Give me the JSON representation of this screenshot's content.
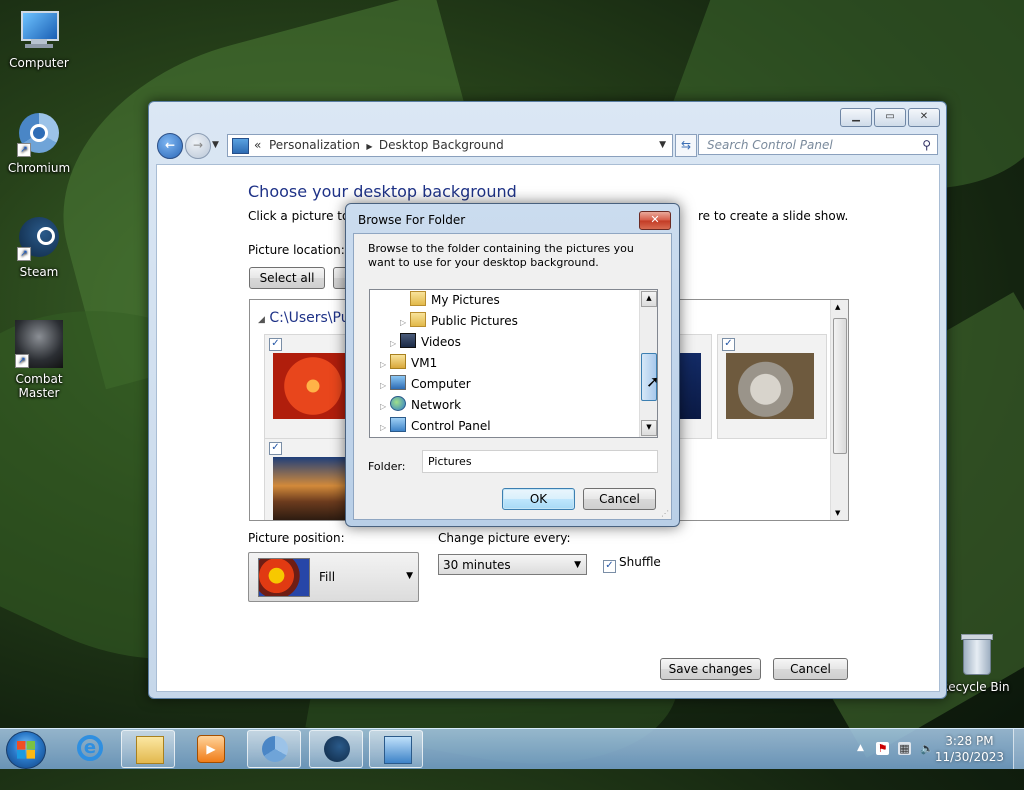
{
  "desktop": {
    "icons": [
      {
        "label": "Computer"
      },
      {
        "label": "Chromium"
      },
      {
        "label": "Steam"
      },
      {
        "label": "Combat Master"
      },
      {
        "label": "Recycle Bin"
      }
    ]
  },
  "window": {
    "breadcrumb_prefix": "«",
    "breadcrumb": [
      "Personalization",
      "Desktop Background"
    ],
    "search_placeholder": "Search Control Panel",
    "heading": "Choose your desktop background",
    "intro_left": "Click a picture to m",
    "intro_right": "re to create a slide show.",
    "picture_location_label": "Picture location:",
    "select_all_label": "Select all",
    "gallery_path": "C:\\Users\\Pu",
    "picture_position_label": "Picture position:",
    "picture_position_value": "Fill",
    "change_picture_label": "Change picture every:",
    "change_picture_value": "30 minutes",
    "shuffle_label": "Shuffle",
    "save_label": "Save changes",
    "cancel_label": "Cancel"
  },
  "dialog": {
    "title": "Browse For Folder",
    "close_glyph": "✕",
    "description": "Browse to the folder containing the pictures you want to use for your desktop background.",
    "tree_items": [
      {
        "label": "My Pictures",
        "icon": "folder-icon",
        "expander": ""
      },
      {
        "label": "Public Pictures",
        "icon": "folder-icon",
        "expander": "▷"
      },
      {
        "label": "Videos",
        "icon": "video-library-icon",
        "expander": "▷"
      },
      {
        "label": "VM1",
        "icon": "user-folder-icon",
        "expander": "▷"
      },
      {
        "label": "Computer",
        "icon": "computer-icon",
        "expander": "▷"
      },
      {
        "label": "Network",
        "icon": "network-icon",
        "expander": "▷"
      },
      {
        "label": "Control Panel",
        "icon": "control-panel-icon",
        "expander": "▷"
      }
    ],
    "folder_label": "Folder:",
    "folder_value": "Pictures",
    "ok_label": "OK",
    "cancel_label": "Cancel"
  },
  "taskbar": {
    "time": "3:28 PM",
    "date": "11/30/2023",
    "pinned": [
      "internet-explorer-icon",
      "file-explorer-icon",
      "media-player-icon",
      "chromium-icon",
      "steam-icon",
      "control-panel-icon"
    ]
  },
  "colors": {
    "heading": "#1e3287",
    "accent": "#3c7fb1"
  }
}
